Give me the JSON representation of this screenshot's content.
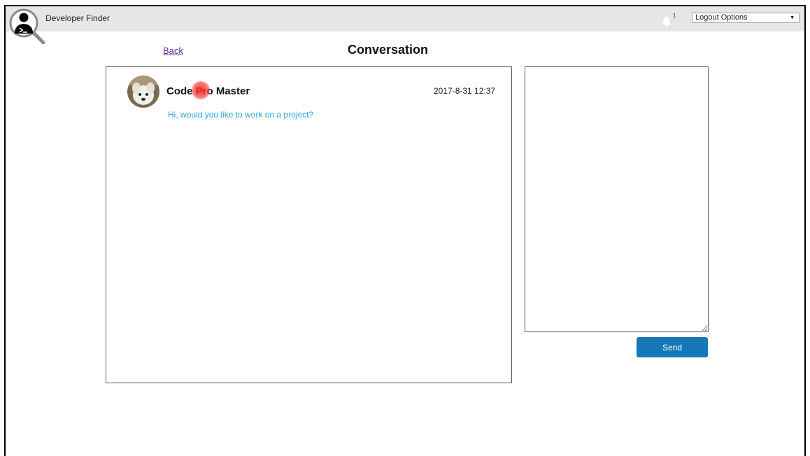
{
  "header": {
    "app_title": "Developer Finder",
    "notification_count": "1",
    "logout_select": {
      "selected": "Logout Options"
    },
    "icons": {
      "logo": "developer-search-logo-icon",
      "notifications": "bell-icon",
      "dropdown": "caret-down-icon"
    }
  },
  "page": {
    "back_label": "Back",
    "title": "Conversation"
  },
  "conversation": {
    "messages": [
      {
        "sender": "Code Pro Master",
        "timestamp": "2017-8-31 12:37",
        "text": "Hi, would you like to work on a project?",
        "avatar": "dog-avatar-icon"
      }
    ]
  },
  "reply": {
    "value": "",
    "send_label": "Send"
  },
  "colors": {
    "topbar_bg": "#e6e6e6",
    "link": "#5b2d91",
    "message_text": "#2aa4e0",
    "send_button": "#1778b8"
  }
}
